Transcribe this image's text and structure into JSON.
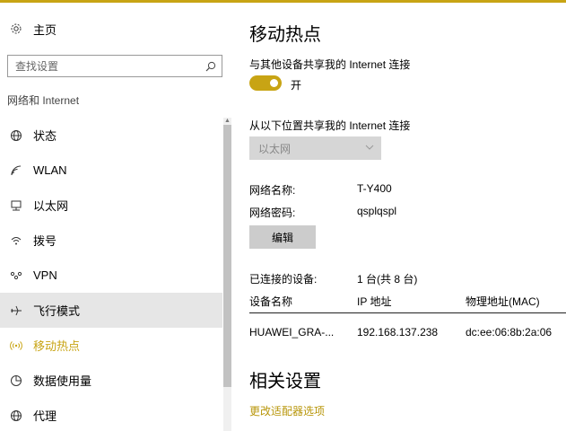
{
  "sidebar": {
    "home_label": "主页",
    "search_placeholder": "查找设置",
    "section_title": "网络和 Internet",
    "items": [
      {
        "label": "状态",
        "icon": "globe-icon"
      },
      {
        "label": "WLAN",
        "icon": "wifi-icon"
      },
      {
        "label": "以太网",
        "icon": "ethernet-icon"
      },
      {
        "label": "拨号",
        "icon": "dialup-icon"
      },
      {
        "label": "VPN",
        "icon": "vpn-icon"
      },
      {
        "label": "飞行模式",
        "icon": "airplane-icon"
      },
      {
        "label": "移动热点",
        "icon": "hotspot-icon"
      },
      {
        "label": "数据使用量",
        "icon": "data-usage-icon"
      },
      {
        "label": "代理",
        "icon": "globe-icon"
      }
    ],
    "selected_item": "飞行模式",
    "active_item": "移动热点"
  },
  "main": {
    "title": "移动热点",
    "share_label": "与其他设备共享我的 Internet 连接",
    "toggle_state": "开",
    "share_from_label": "从以下位置共享我的 Internet 连接",
    "share_from_value": "以太网",
    "network_name_label": "网络名称:",
    "network_name_value": "T-Y400",
    "network_password_label": "网络密码:",
    "network_password_value": "qsplqspl",
    "edit_button": "编辑",
    "connected_label": "已连接的设备:",
    "connected_value": "1 台(共 8 台)",
    "table": {
      "headers": [
        "设备名称",
        "IP 地址",
        "物理地址(MAC)"
      ],
      "rows": [
        [
          "HUAWEI_GRA-...",
          "192.168.137.238",
          "dc:ee:06:8b:2a:06"
        ]
      ]
    },
    "related_title": "相关设置",
    "related_link": "更改适配器选项"
  },
  "colors": {
    "accent": "#c8a414",
    "selected_bg": "#e6e6e6"
  }
}
